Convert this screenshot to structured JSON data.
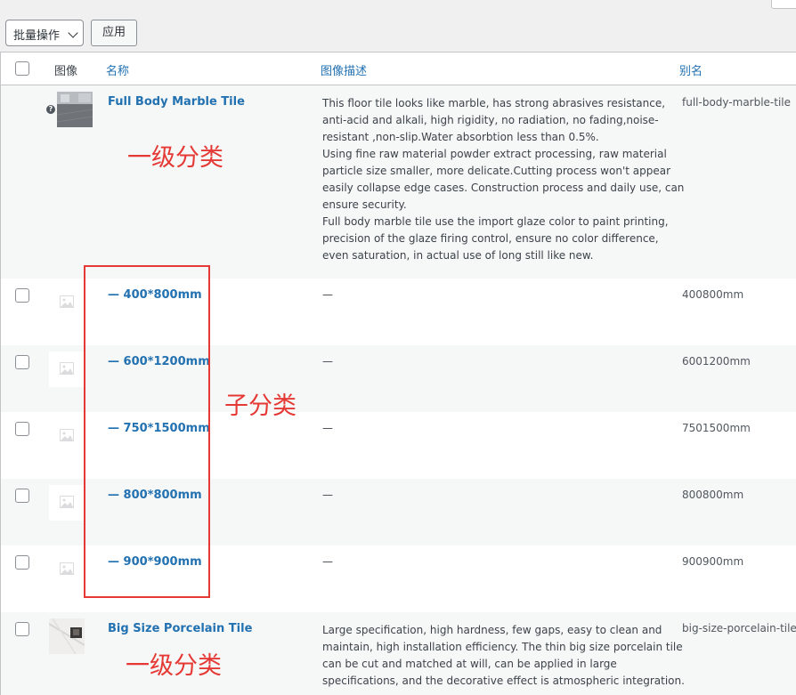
{
  "toolbar": {
    "bulk_label": "批量操作",
    "apply_label": "应用"
  },
  "columns": {
    "image": "图像",
    "name": "名称",
    "description": "图像描述",
    "slug": "别名"
  },
  "rows": [
    {
      "name": "Full Body Marble Tile",
      "description_lines": [
        "This floor tile looks like marble, has strong abrasives resistance,",
        "anti-acid and alkali, high rigidity, no radiation, no fading,noise-",
        "resistant ,non-slip.Water absorbtion less than 0.5%.",
        "Using fine raw material powder extract processing, raw material",
        "particle size smaller, more delicate.Cutting process won't appear",
        "easily collapse edge cases. Construction process and daily use, can",
        "ensure security.",
        "Full body marble tile use the import glaze color to paint printing,",
        "precision of the glaze firing control, ensure no color difference,",
        "even saturation, in actual use of long still like new."
      ],
      "slug": "full-body-marble-tile",
      "help_mark": "?"
    },
    {
      "name": "— 400*800mm",
      "description": "—",
      "slug": "400800mm"
    },
    {
      "name": "— 600*1200mm",
      "description": "—",
      "slug": "6001200mm"
    },
    {
      "name": "— 750*1500mm",
      "description": "—",
      "slug": "7501500mm"
    },
    {
      "name": "— 800*800mm",
      "description": "—",
      "slug": "800800mm"
    },
    {
      "name": "— 900*900mm",
      "description": "—",
      "slug": "900900mm"
    },
    {
      "name": "Big Size Porcelain Tile",
      "description_lines": [
        "Large specification, high hardness, few gaps, easy to clean and",
        "maintain, high installation efficiency. The thin big size porcelain tile",
        "can be cut and matched at will, can be applied in large",
        "specifications, and the decorative effect is atmospheric integration."
      ],
      "slug": "big-size-porcelain-tile"
    }
  ],
  "annotations": {
    "top_level_1": "一级分类",
    "sub": "子分类",
    "top_level_2": "一级分类"
  },
  "colors": {
    "link": "#2271b1",
    "annotation": "#e53935",
    "alt_row": "#f6f7f7"
  }
}
